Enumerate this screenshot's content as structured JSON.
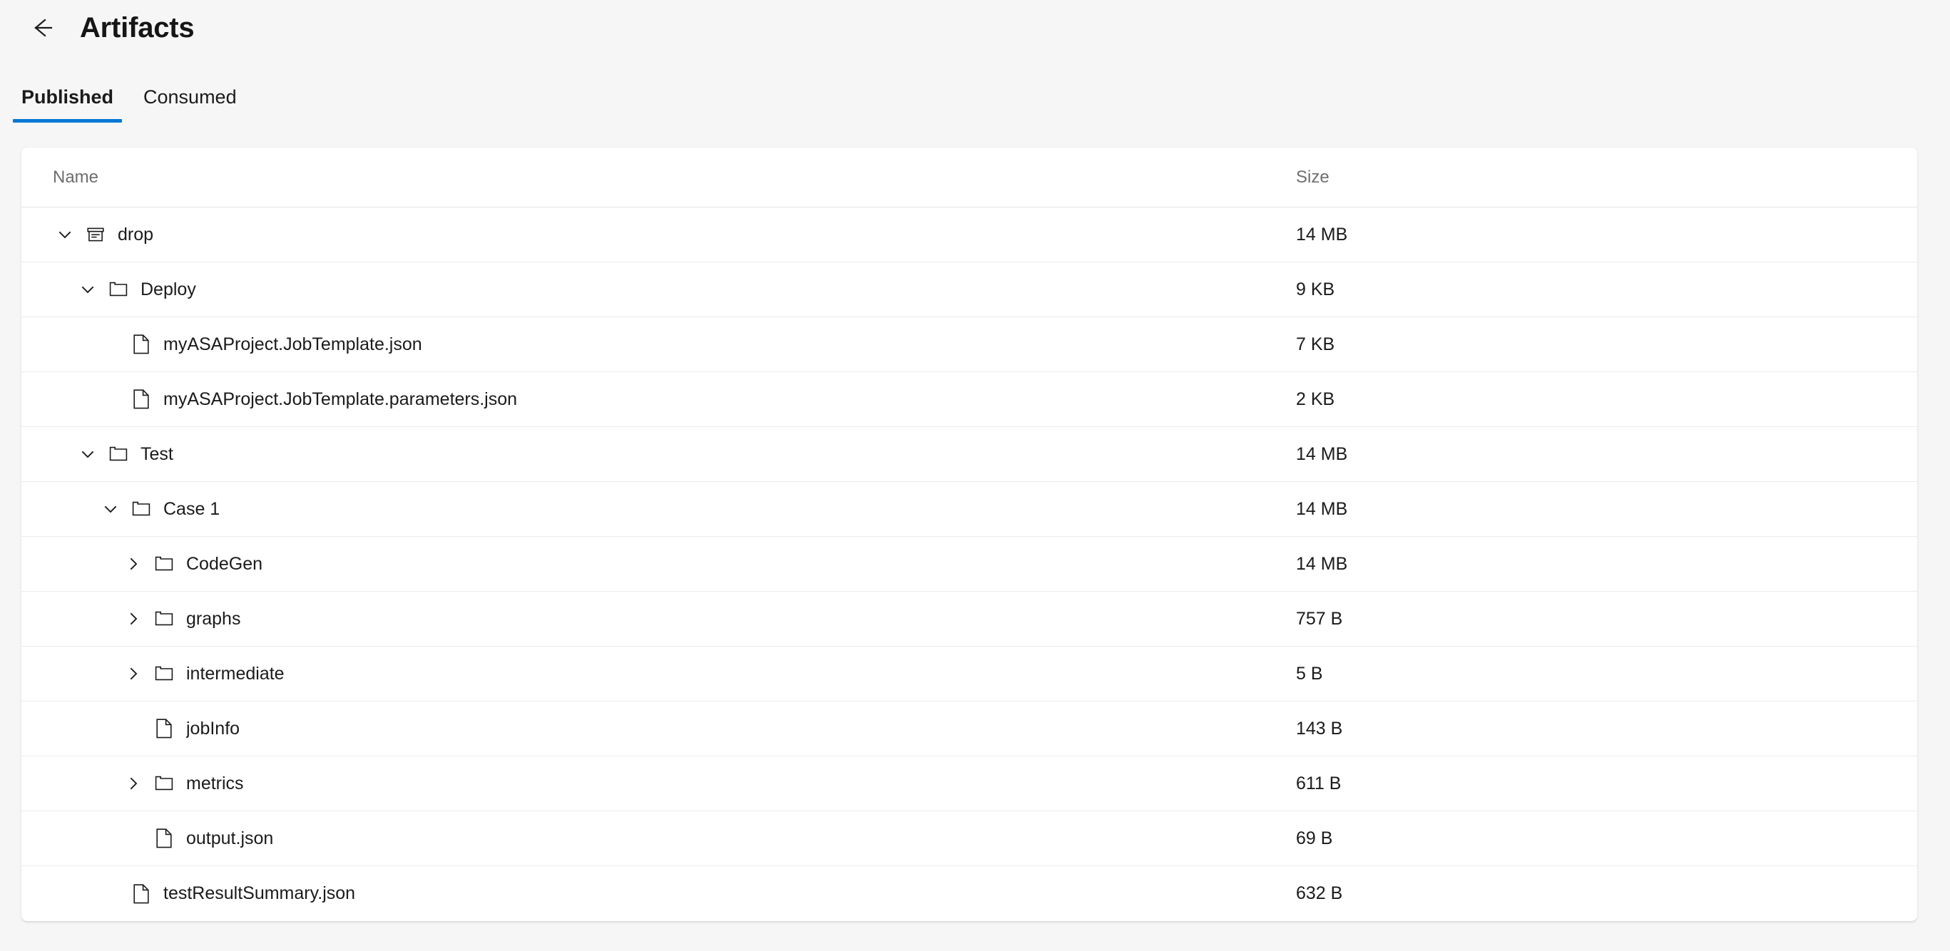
{
  "header": {
    "back_icon": "arrow-left-icon",
    "title": "Artifacts"
  },
  "tabs": [
    {
      "label": "Published",
      "selected": true
    },
    {
      "label": "Consumed",
      "selected": false
    }
  ],
  "table": {
    "columns": [
      {
        "key": "name",
        "label": "Name"
      },
      {
        "key": "size",
        "label": "Size"
      }
    ],
    "rows": [
      {
        "name": "drop",
        "size": "14 MB",
        "depth": 0,
        "icon": "archive-box-icon",
        "expander": "expanded"
      },
      {
        "name": "Deploy",
        "size": "9 KB",
        "depth": 1,
        "icon": "folder-icon",
        "expander": "expanded"
      },
      {
        "name": "myASAProject.JobTemplate.json",
        "size": "7 KB",
        "depth": 2,
        "icon": "file-icon",
        "expander": "none"
      },
      {
        "name": "myASAProject.JobTemplate.parameters.json",
        "size": "2 KB",
        "depth": 2,
        "icon": "file-icon",
        "expander": "none"
      },
      {
        "name": "Test",
        "size": "14 MB",
        "depth": 1,
        "icon": "folder-icon",
        "expander": "expanded"
      },
      {
        "name": "Case 1",
        "size": "14 MB",
        "depth": 2,
        "icon": "folder-icon",
        "expander": "expanded"
      },
      {
        "name": "CodeGen",
        "size": "14 MB",
        "depth": 3,
        "icon": "folder-icon",
        "expander": "collapsed"
      },
      {
        "name": "graphs",
        "size": "757 B",
        "depth": 3,
        "icon": "folder-icon",
        "expander": "collapsed"
      },
      {
        "name": "intermediate",
        "size": "5 B",
        "depth": 3,
        "icon": "folder-icon",
        "expander": "collapsed"
      },
      {
        "name": "jobInfo",
        "size": "143 B",
        "depth": 3,
        "icon": "file-icon",
        "expander": "none"
      },
      {
        "name": "metrics",
        "size": "611 B",
        "depth": 3,
        "icon": "folder-icon",
        "expander": "collapsed"
      },
      {
        "name": "output.json",
        "size": "69 B",
        "depth": 3,
        "icon": "file-icon",
        "expander": "none"
      },
      {
        "name": "testResultSummary.json",
        "size": "632 B",
        "depth": 2,
        "icon": "file-icon",
        "expander": "none"
      }
    ]
  },
  "colors": {
    "accent": "#0078d4",
    "page_background": "#f6f6f6",
    "card_background": "#ffffff",
    "text": "#1b1b1b",
    "muted_text": "#6e6e6e",
    "divider": "#ebebeb"
  }
}
